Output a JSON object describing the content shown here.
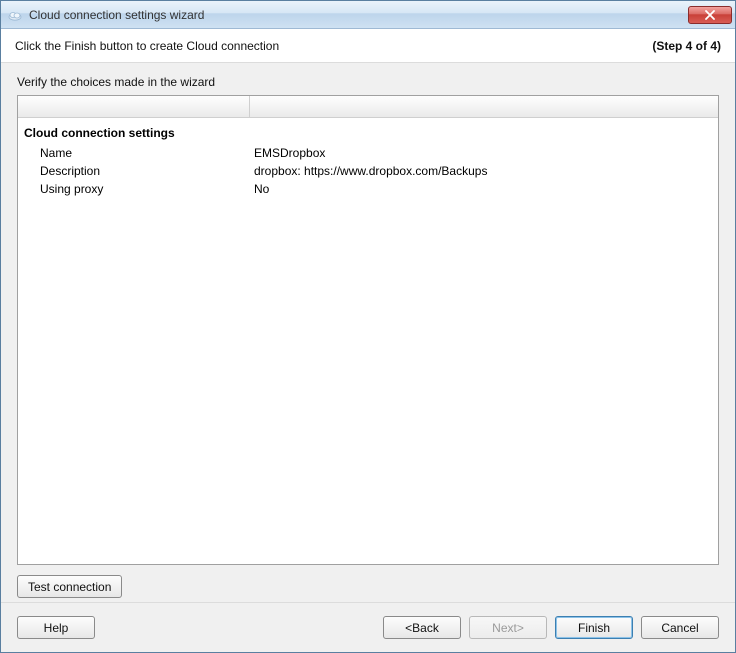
{
  "window": {
    "title": "Cloud connection settings wizard"
  },
  "header": {
    "instruction": "Click the Finish button to create Cloud connection",
    "step": "(Step 4 of 4)"
  },
  "content": {
    "verify_label": "Verify the choices made in the wizard",
    "section_title": "Cloud connection settings",
    "rows": {
      "name_label": "Name",
      "name_value": "EMSDropbox",
      "description_label": "Description",
      "description_value": "dropbox: https://www.dropbox.com/Backups",
      "proxy_label": "Using proxy",
      "proxy_value": "No"
    }
  },
  "buttons": {
    "test": "Test connection",
    "help": "Help",
    "back": "<Back",
    "next": "Next>",
    "finish": "Finish",
    "cancel": "Cancel"
  }
}
